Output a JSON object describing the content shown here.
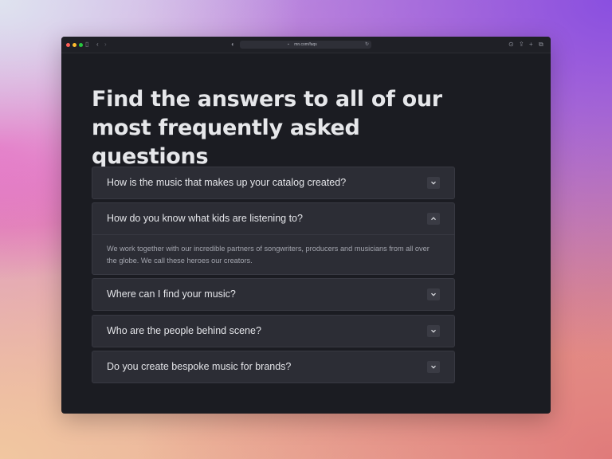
{
  "browser": {
    "url": "mn.com/faqs"
  },
  "page": {
    "title": "Find the answers to all of our most frequently asked questions"
  },
  "faqs": [
    {
      "question": "How is the music that makes up your catalog created?",
      "expanded": false
    },
    {
      "question": "How do you know what kids are listening to?",
      "expanded": true,
      "answer": "We work together with our incredible partners of songwriters, producers and musicians from all over the globe. We call these heroes our creators."
    },
    {
      "question": "Where can I find your music?",
      "expanded": false
    },
    {
      "question": "Who are the people behind scene?",
      "expanded": false
    },
    {
      "question": "Do you create bespoke music for brands?",
      "expanded": false
    }
  ],
  "icons": {
    "collapsed": "chevron-down-icon",
    "expanded": "chevron-up-icon"
  },
  "colors": {
    "window_bg": "#1b1c22",
    "card_bg": "#2c2d35",
    "traffic_red": "#ff5f57",
    "traffic_yellow": "#febc2e",
    "traffic_green": "#28c840"
  }
}
